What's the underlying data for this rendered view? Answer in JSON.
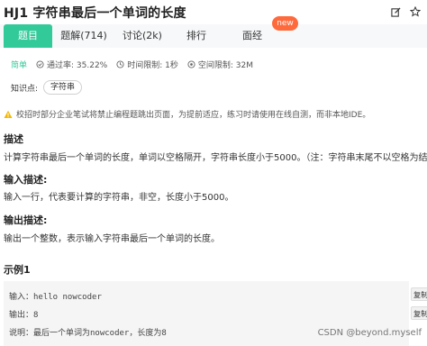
{
  "header": {
    "title": "HJ1  字符串最后一个单词的长度"
  },
  "tabs": [
    {
      "label": "题目"
    },
    {
      "label": "题解(714)"
    },
    {
      "label": "讨论(2k)"
    },
    {
      "label": "排行"
    },
    {
      "label": "面经"
    }
  ],
  "new_badge": "new",
  "meta": {
    "difficulty": "简单",
    "pass_rate": "通过率: 35.22%",
    "time_limit": "时间限制: 1秒",
    "space_limit": "空间限制: 32M"
  },
  "knowledge": {
    "label": "知识点:",
    "tag": "字符串"
  },
  "notice": "校招时部分企业笔试将禁止编程题跳出页面，为提前适应，练习时请使用在线自测，而非本地IDE。",
  "description": {
    "heading": "描述",
    "text": "计算字符串最后一个单词的长度，单词以空格隔开，字符串长度小于5000。（注：字符串末尾不以空格为结尾）"
  },
  "input_desc": {
    "heading": "输入描述:",
    "text": "输入一行，代表要计算的字符串，非空，长度小于5000。"
  },
  "output_desc": {
    "heading": "输出描述:",
    "text": "输出一个整数，表示输入字符串最后一个单词的长度。"
  },
  "example": {
    "heading": "示例1",
    "input": "输入：hello nowcoder",
    "output": "输出：8",
    "explain": "说明：最后一个单词为nowcoder，长度为8"
  },
  "copy_label": "复制",
  "watermark": "CSDN @beyond.myself",
  "colors": {
    "accent": "#32ca99",
    "new_badge": "#ff6a3d",
    "warning": "#f5b800"
  }
}
